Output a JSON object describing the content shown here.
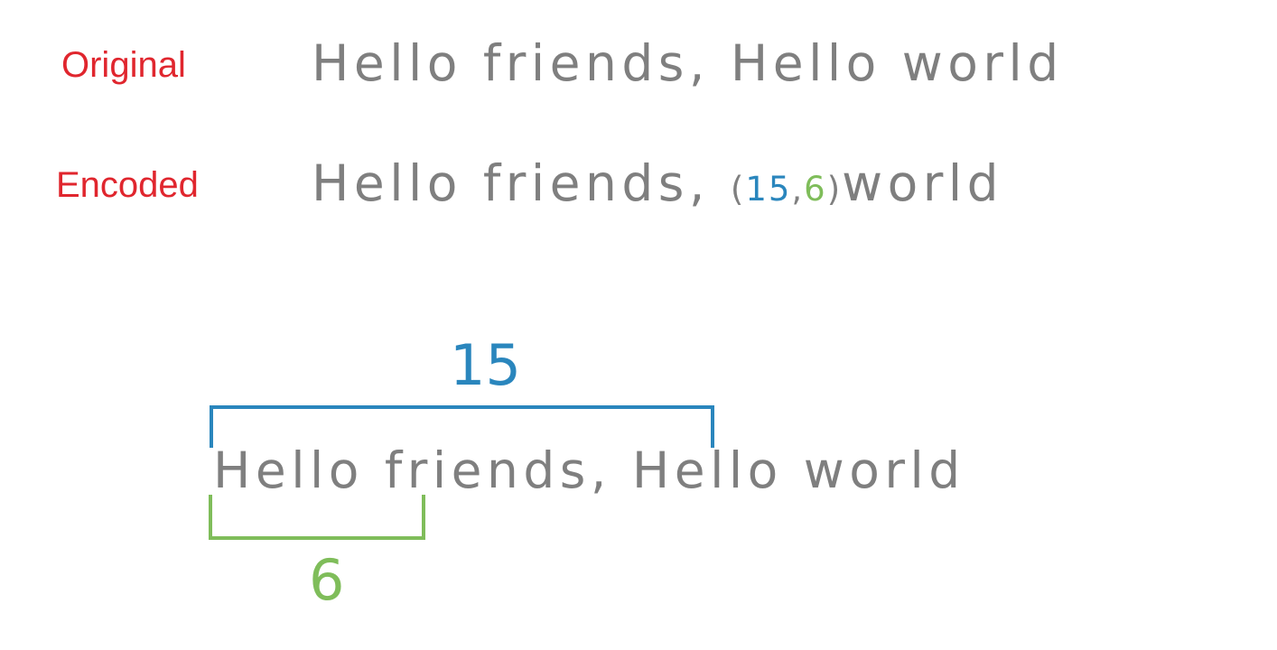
{
  "colors": {
    "label": "#e0262e",
    "text": "#7f7f7f",
    "offset": "#2a86bd",
    "length": "#7fbd5a"
  },
  "rows": {
    "original": {
      "label": "Original",
      "text": "Hello friends, Hello world"
    },
    "encoded": {
      "label": "Encoded",
      "prefix": "Hello friends, ",
      "open_paren": "(",
      "offset": "15",
      "comma": ",",
      "length": "6",
      "close_paren": ")",
      "suffix": "world"
    }
  },
  "illustration": {
    "text": "Hello friends, Hello world",
    "offset_label": "15",
    "length_label": "6"
  }
}
